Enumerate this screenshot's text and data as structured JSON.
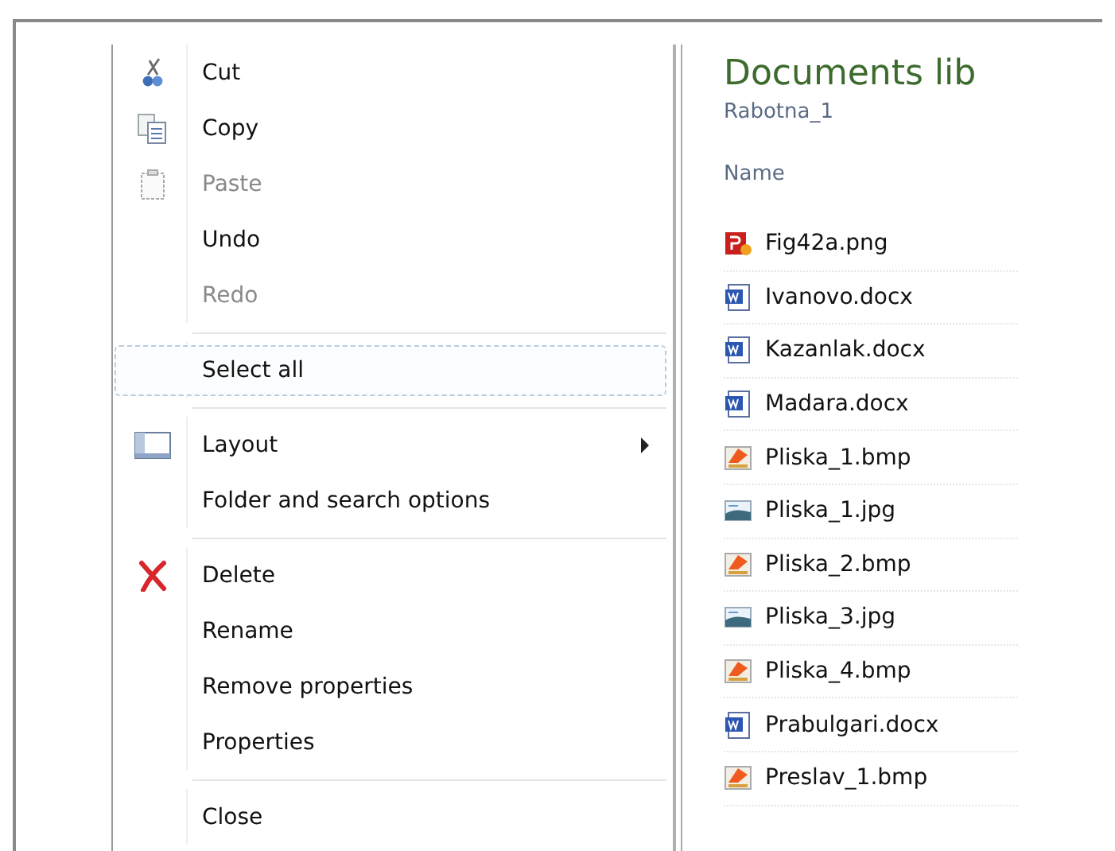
{
  "context_menu": {
    "items": [
      {
        "kind": "cut",
        "label": "Cut",
        "disabled": false,
        "selected": false
      },
      {
        "kind": "copy",
        "label": "Copy",
        "disabled": false,
        "selected": false
      },
      {
        "kind": "paste",
        "label": "Paste",
        "disabled": true,
        "selected": false
      },
      {
        "kind": "plain",
        "label": "Undo",
        "disabled": false,
        "selected": false
      },
      {
        "kind": "plain",
        "label": "Redo",
        "disabled": true,
        "selected": false
      },
      {
        "kind": "separator"
      },
      {
        "kind": "plain",
        "label": "Select all",
        "disabled": false,
        "selected": true
      },
      {
        "kind": "separator"
      },
      {
        "kind": "layout",
        "label": "Layout",
        "disabled": false,
        "selected": false,
        "submenu": true
      },
      {
        "kind": "plain",
        "label": "Folder and search options",
        "disabled": false,
        "selected": false
      },
      {
        "kind": "separator"
      },
      {
        "kind": "delete",
        "label": "Delete",
        "disabled": false,
        "selected": false
      },
      {
        "kind": "plain",
        "label": "Rename",
        "disabled": false,
        "selected": false
      },
      {
        "kind": "plain",
        "label": "Remove properties",
        "disabled": false,
        "selected": false
      },
      {
        "kind": "plain",
        "label": "Properties",
        "disabled": false,
        "selected": false
      },
      {
        "kind": "separator"
      },
      {
        "kind": "plain",
        "label": "Close",
        "disabled": false,
        "selected": false
      }
    ]
  },
  "library": {
    "title": "Documents lib",
    "subtitle": "Rabotna_1",
    "column": "Name",
    "files": [
      {
        "kind": "png",
        "name": "Fig42a.png"
      },
      {
        "kind": "docx",
        "name": "Ivanovo.docx"
      },
      {
        "kind": "docx",
        "name": "Kazanlak.docx"
      },
      {
        "kind": "docx",
        "name": "Madara.docx"
      },
      {
        "kind": "bmp",
        "name": "Pliska_1.bmp"
      },
      {
        "kind": "jpg",
        "name": "Pliska_1.jpg"
      },
      {
        "kind": "bmp",
        "name": "Pliska_2.bmp"
      },
      {
        "kind": "jpg",
        "name": "Pliska_3.jpg"
      },
      {
        "kind": "bmp",
        "name": "Pliska_4.bmp"
      },
      {
        "kind": "docx",
        "name": "Prabulgari.docx"
      },
      {
        "kind": "bmp",
        "name": "Preslav_1.bmp"
      }
    ]
  }
}
